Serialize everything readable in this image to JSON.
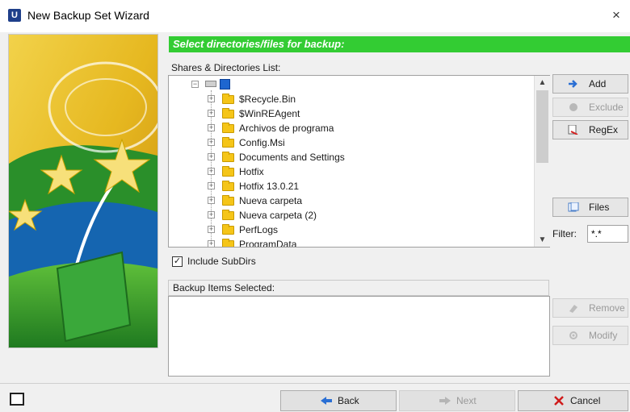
{
  "window": {
    "title": "New Backup Set Wizard",
    "app_icon_letter": "U",
    "close_glyph": "×"
  },
  "header": {
    "text": "Select directories/files for backup:",
    "color": "#33cc33"
  },
  "shares": {
    "label": "Shares & Directories List:",
    "items": [
      "$Recycle.Bin",
      "$WinREAgent",
      "Archivos de programa",
      "Config.Msi",
      "Documents and Settings",
      "Hotfix",
      "Hotfix 13.0.21",
      "Nueva carpeta",
      "Nueva carpeta (2)",
      "PerfLogs",
      "ProgramData"
    ]
  },
  "buttons": {
    "add": "Add",
    "exclude": "Exclude",
    "regex": "RegEx",
    "files": "Files",
    "remove": "Remove",
    "modify": "Modify"
  },
  "filter": {
    "label": "Filter:",
    "value": "*.*"
  },
  "include_subdirs": {
    "label": "Include SubDirs",
    "checked": true
  },
  "selected": {
    "label": "Backup Items Selected:"
  },
  "footer": {
    "back": "Back",
    "next": "Next",
    "cancel": "Cancel"
  },
  "icons": {
    "add": "add-arrow-icon",
    "exclude": "exclude-circle-icon",
    "regex": "regex-icon",
    "files": "files-icon",
    "remove": "remove-eraser-icon",
    "modify": "modify-gear-icon",
    "back": "back-arrow-icon",
    "next": "next-arrow-icon",
    "cancel": "cancel-x-icon"
  }
}
